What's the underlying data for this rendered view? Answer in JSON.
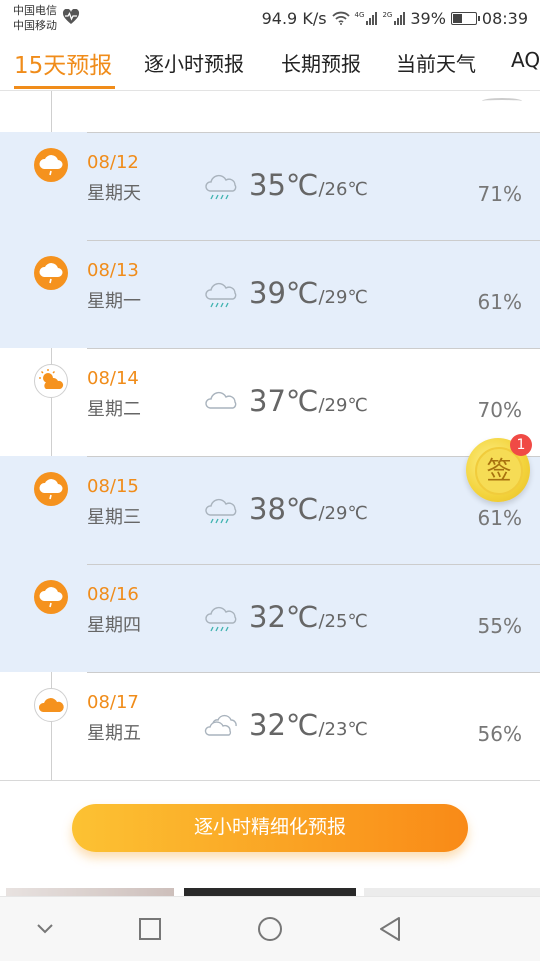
{
  "status_bar": {
    "carrier_1": "中国电信",
    "carrier_2": "中国移动",
    "net_speed": "94.9 K/s",
    "signal_1_tag": "4G",
    "signal_2_tag": "2G",
    "battery": "39%",
    "battery_level": 0.39,
    "time": "08:39"
  },
  "tabs": [
    {
      "label": "15天预报",
      "active": true
    },
    {
      "label": "逐小时预报",
      "active": false
    },
    {
      "label": "长期预报",
      "active": false
    },
    {
      "label": "当前天气",
      "active": false
    },
    {
      "label": "AQ",
      "active": false
    }
  ],
  "days": [
    {
      "date": "08/12",
      "weekday": "星期天",
      "high": "35℃",
      "low": "/26℃",
      "humidity": "71%",
      "icon": "rain-cloud-icon"
    },
    {
      "date": "08/13",
      "weekday": "星期一",
      "high": "39℃",
      "low": "/29℃",
      "humidity": "61%",
      "icon": "rain-cloud-icon"
    },
    {
      "date": "08/14",
      "weekday": "星期二",
      "high": "37℃",
      "low": "/29℃",
      "humidity": "70%",
      "icon": "partly-cloudy-icon"
    },
    {
      "date": "08/15",
      "weekday": "星期三",
      "high": "38℃",
      "low": "/29℃",
      "humidity": "61%",
      "icon": "rain-cloud-icon"
    },
    {
      "date": "08/16",
      "weekday": "星期四",
      "high": "32℃",
      "low": "/25℃",
      "humidity": "55%",
      "icon": "rain-cloud-icon"
    },
    {
      "date": "08/17",
      "weekday": "星期五",
      "high": "32℃",
      "low": "/23℃",
      "humidity": "56%",
      "icon": "cloudy-icon"
    }
  ],
  "hourly_button": "逐小时精细化预报",
  "signin": {
    "label": "签",
    "badge": "1"
  },
  "colors": {
    "accent": "#f08c1a",
    "row_highlight": "#e5eefa",
    "badge": "#f04a45"
  }
}
